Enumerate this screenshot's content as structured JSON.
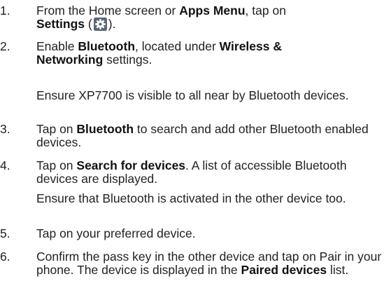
{
  "steps": [
    {
      "number": "1.",
      "line1_pre": "From the Home screen or ",
      "apps_menu": "Apps Menu",
      "line1_post": ", tap on",
      "settings": "Settings",
      "paren_open": " (",
      "gear_icon": "settings-gear-icon",
      "paren_close": ")."
    },
    {
      "number": "2.",
      "pre": "Enable ",
      "bluetooth": "Bluetooth",
      "mid": ", located under ",
      "wireless": "Wireless &",
      "networking": "Networking",
      "post": " settings.",
      "note": "Ensure XP7700 is visible to all near by Bluetooth devices."
    },
    {
      "number": "3.",
      "pre": "Tap on ",
      "bluetooth": "Bluetooth",
      "post": " to search and add other Bluetooth enabled devices."
    },
    {
      "number": "4.",
      "pre": "Tap on ",
      "search": "Search for devices",
      "post": ". A list of accessible Bluetooth devices are displayed.",
      "note": "Ensure that Bluetooth is activated in the other device too."
    },
    {
      "number": "5.",
      "text": "Tap on your preferred device."
    },
    {
      "number": "6.",
      "pre": "Confirm the pass key in the other device and tap on Pair in your phone. The device is displayed in the ",
      "paired": "Paired devices",
      "post": " list."
    }
  ],
  "colors": {
    "text": "#222222",
    "icon_bg": "#5a6672",
    "icon_fg": "#ffffff"
  }
}
